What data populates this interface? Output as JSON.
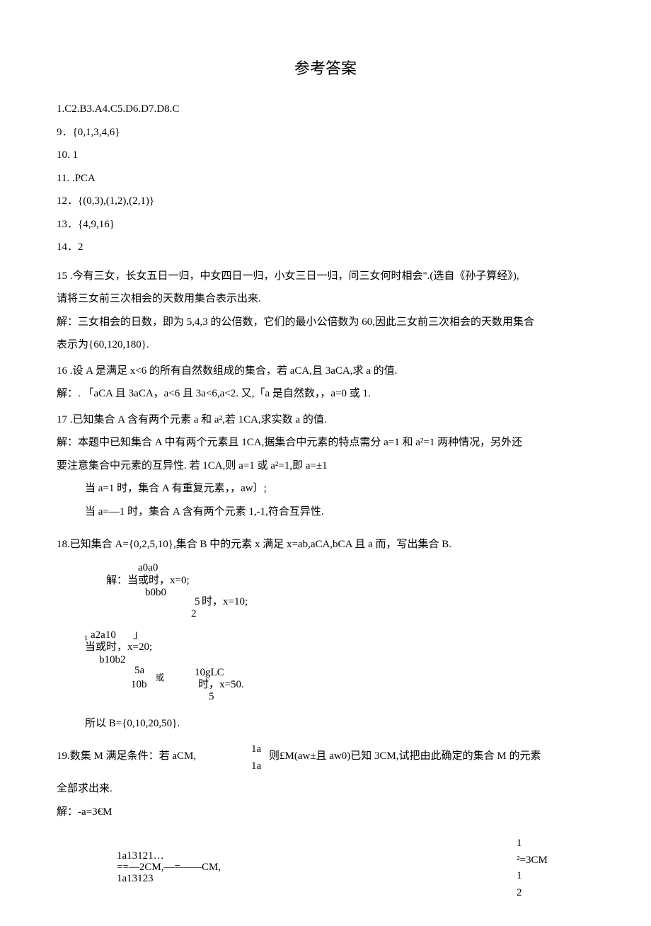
{
  "title": "参考答案",
  "ans1_8": "1.C2.B3.A4.C5.D6.D7.D8.C",
  "ans9": "9．{0,1,3,4,6}",
  "ans10": "10. 1",
  "ans11": "11. .PCA",
  "ans12": "12．{(0,3),(1,2),(2,1)}",
  "ans13": "13．{4,9,16}",
  "ans14": "14．2",
  "q15_l1": "15 .今有三女，长女五日一归，中女四日一归，小女三日一归，问三女何时相会\".(选自《孙子算经》),",
  "q15_l2": "请将三女前三次相会的天数用集合表示出来.",
  "q15_l3": "解：三女相会的日数，即为 5,4,3 的公倍数，它们的最小公倍数为 60,因此三女前三次相会的天数用集合",
  "q15_l4": "表示为{60,120,180}.",
  "q16_l1": "16 .设 A 是满足 x<6 的所有自然数组成的集合，若 aCA,且 3aCA,求 a 的值.",
  "q16_l2": "解：. 「aCA 且 3aCA，a<6 且 3a<6,a<2. 又,「a 是自然数，，a=0 或 1.",
  "q17_l1": "17 .已知集合 A 含有两个元素 a 和 a²,若 1CA,求实数 a 的值.",
  "q17_l2": "解：本题中已知集合 A 中有两个元素且 1CA,据集合中元素的特点需分 a=1 和 a²=1 两种情况，另外还",
  "q17_l3": "要注意集合中元素的互异性. 若 1CA,则 a=1 或 a²=1,即 a=±1",
  "q17_l4": "当 a=1 时，集合 A 有重复元素，，aw〕;",
  "q17_l5": "当 a=—1 时，集合 A 含有两个元素 1,-1,符合互异性.",
  "q18_l1": "18.已知集合 A={0,2,5,10},集合 B 中的元素 x 满足 x=ab,aCA,bCA 且 a 而，写出集合 B.",
  "q18_a0": "a0a0",
  "q18_sol1": "解：当或时，x=0;",
  "q18_b0": "b0b0",
  "q18_five": "5",
  "q18_x10": "时，x=10;",
  "q18_two": "2",
  "q18_a2": "a2a10",
  "q18_t": "t",
  "q18_right": "」",
  "q18_sol2": "当或时，x=20;",
  "q18_b10": "b10b2",
  "q18_5a": "5a",
  "q18_huo": "或",
  "q18_10glc": "10gLC",
  "q18_10b": "10b",
  "q18_x50": "时，x=50.",
  "q18_5": "5",
  "q18_B": "所以 B={0,10,20,50}.",
  "q19_l1a": "19.数集 M 满足条件：若 aCM,",
  "q19_1a_top": "1a",
  "q19_l1b": "则£M(aw±且 aw0)已知 3CM,试把由此确定的集合 M 的元素",
  "q19_1a_bot": "1a",
  "q19_l2": "全部求出来.",
  "q19_l3": "解：-a=3€M",
  "bottom_l1": "1a13121…",
  "bottom_l2": "==—2CM,—=——CM,",
  "bottom_l3": "1a13123",
  "bottom_r1": "1",
  "bottom_r2": "²=3CM",
  "bottom_r3": "1",
  "bottom_r4": "2"
}
